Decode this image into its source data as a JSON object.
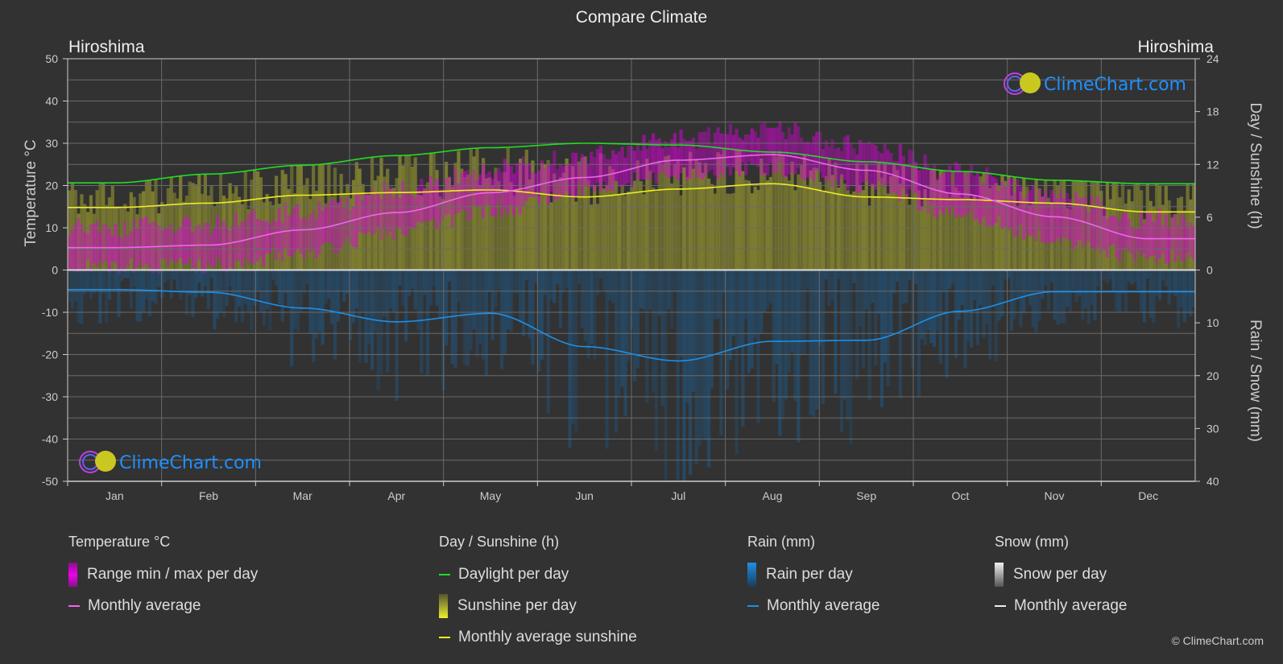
{
  "title": "Compare Climate",
  "location_left": "Hiroshima",
  "location_right": "Hiroshima",
  "watermark": "ClimeChart.com",
  "copyright": "© ClimeChart.com",
  "colors": {
    "background": "#323232",
    "daylight": "#22dd22",
    "sunshine_avg": "#eeee22",
    "temp_avg": "#ee66ee",
    "rain_avg": "#1e8fe6",
    "temp_range": "#dd00dd",
    "sunshine_fill": "#8a8a30",
    "rain_fill": "#1e5a8a"
  },
  "legend": {
    "temperature": {
      "heading": "Temperature °C",
      "range_label": "Range min / max per day",
      "avg_label": "Monthly average"
    },
    "sunshine": {
      "heading": "Day / Sunshine (h)",
      "daylight_label": "Daylight per day",
      "sunshine_label": "Sunshine per day",
      "avg_label": "Monthly average sunshine"
    },
    "rain": {
      "heading": "Rain (mm)",
      "per_day_label": "Rain per day",
      "avg_label": "Monthly average"
    },
    "snow": {
      "heading": "Snow (mm)",
      "per_day_label": "Snow per day",
      "avg_label": "Monthly average"
    }
  },
  "chart_data": {
    "type": "line",
    "title": "Compare Climate",
    "categories": [
      "Jan",
      "Feb",
      "Mar",
      "Apr",
      "May",
      "Jun",
      "Jul",
      "Aug",
      "Sep",
      "Oct",
      "Nov",
      "Dec"
    ],
    "axes": {
      "left": {
        "label": "Temperature °C",
        "range": [
          -50,
          50
        ],
        "ticks": [
          50,
          40,
          30,
          20,
          10,
          0,
          -10,
          -20,
          -30,
          -40,
          -50
        ]
      },
      "right_top": {
        "label": "Day / Sunshine (h)",
        "range": [
          0,
          24
        ],
        "ticks": [
          24,
          18,
          12,
          6,
          0
        ]
      },
      "right_bottom": {
        "label": "Rain / Snow (mm)",
        "range": [
          0,
          40
        ],
        "ticks": [
          0,
          10,
          20,
          30,
          40
        ]
      }
    },
    "grid": true,
    "series": [
      {
        "name": "Daylight per day",
        "unit": "h",
        "values": [
          9.9,
          10.9,
          11.9,
          13.0,
          13.9,
          14.4,
          14.2,
          13.4,
          12.3,
          11.2,
          10.2,
          9.8
        ]
      },
      {
        "name": "Monthly average sunshine",
        "unit": "h",
        "values": [
          7.1,
          7.6,
          8.5,
          8.8,
          9.1,
          8.3,
          9.2,
          9.8,
          8.3,
          8.0,
          7.6,
          6.6
        ]
      },
      {
        "name": "Temperature monthly average",
        "unit": "°C",
        "values": [
          5.3,
          5.9,
          9.5,
          13.6,
          18.3,
          21.9,
          26.0,
          27.3,
          23.6,
          18.0,
          12.6,
          7.4
        ]
      },
      {
        "name": "Temperature daily max (approx.)",
        "unit": "°C",
        "values": [
          10,
          11,
          14,
          19,
          24,
          27,
          31,
          33,
          29,
          23,
          17,
          12
        ]
      },
      {
        "name": "Temperature daily min (approx.)",
        "unit": "°C",
        "values": [
          1,
          1,
          4,
          9,
          14,
          19,
          23,
          24,
          20,
          13,
          7,
          3
        ]
      },
      {
        "name": "Rain monthly average",
        "unit": "mm",
        "values": [
          3.7,
          4.2,
          7.2,
          9.8,
          8.2,
          14.5,
          17.2,
          13.5,
          13.3,
          7.8,
          4.1,
          4.1
        ]
      },
      {
        "name": "Snow monthly average",
        "unit": "mm",
        "values": [
          0.2,
          0.2,
          0,
          0,
          0,
          0,
          0,
          0,
          0,
          0,
          0,
          0.1
        ]
      }
    ]
  }
}
